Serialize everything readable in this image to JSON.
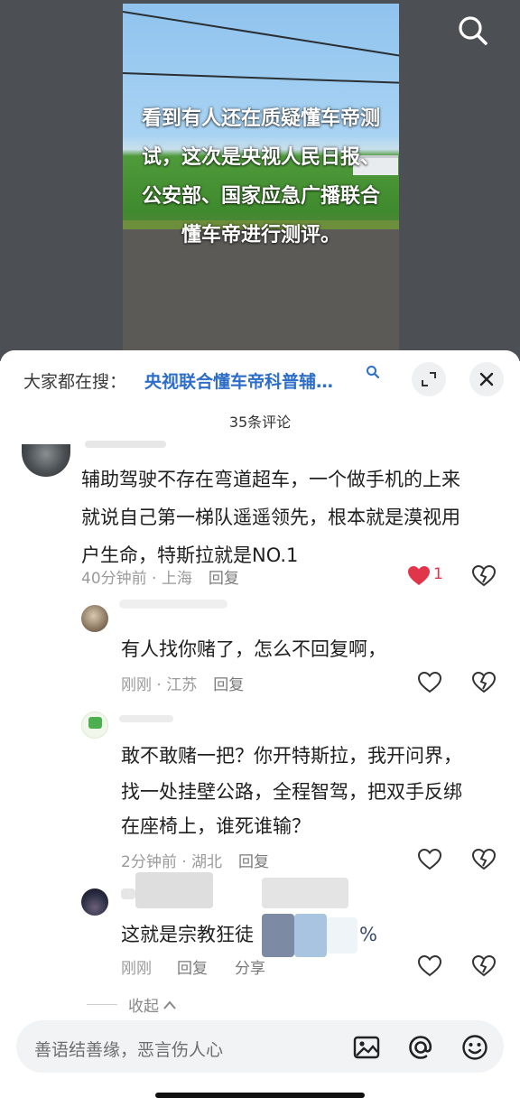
{
  "video": {
    "caption": "看到有人还在质疑懂车帝测试，这次是央视人民日报、公安部、国家应急广播联合懂车帝进行测评。",
    "search_icon": "search-icon"
  },
  "sheet": {
    "hot_search_label": "大家都在搜：",
    "hot_search_query": "央视联合懂车帝科普辅…",
    "comment_count": "35条评论",
    "icons": {
      "expand": "expand-icon",
      "close": "close-icon"
    }
  },
  "comments": [
    {
      "text": "辅助驾驶不存在弯道超车，一个做手机的上来就说自己第一梯队遥遥领先，根本就是漠视用户生命，特斯拉就是NO.1",
      "line1": "辅助驾驶不存在弯道超车，一个做手机的上来",
      "line2": "就说自己第一梯队遥遥领先，根本就是漠视用",
      "line3": "户生命，特斯拉就是NO.1",
      "time_location": "40分钟前 · 上海",
      "reply_label": "回复",
      "like_count": "1",
      "liked": true
    }
  ],
  "replies": [
    {
      "text": "有人找你赌了，怎么不回复啊，",
      "time_location": "刚刚 · 江苏",
      "reply_label": "回复"
    },
    {
      "line1": "敢不敢赌一把？你开特斯拉，我开问界，",
      "line2": "找一处挂壁公路，全程智驾，把双手反绑",
      "line3": "在座椅上，谁死谁输？",
      "time_location": "2分钟前 · 湖北",
      "reply_label": "回复"
    },
    {
      "text_visible": "这就是宗教狂徒",
      "text_tail": "%",
      "time": "刚刚",
      "reply_label": "回复",
      "share_label": "分享"
    }
  ],
  "collapse_label": "收起",
  "input": {
    "placeholder": "善语结善缘，恶言伤人心",
    "icons": [
      "image-icon",
      "at-icon",
      "emoji-icon"
    ]
  },
  "colors": {
    "link": "#2d6ec9",
    "like_active": "#e0354a",
    "meta_gray": "#9a9a9a"
  }
}
